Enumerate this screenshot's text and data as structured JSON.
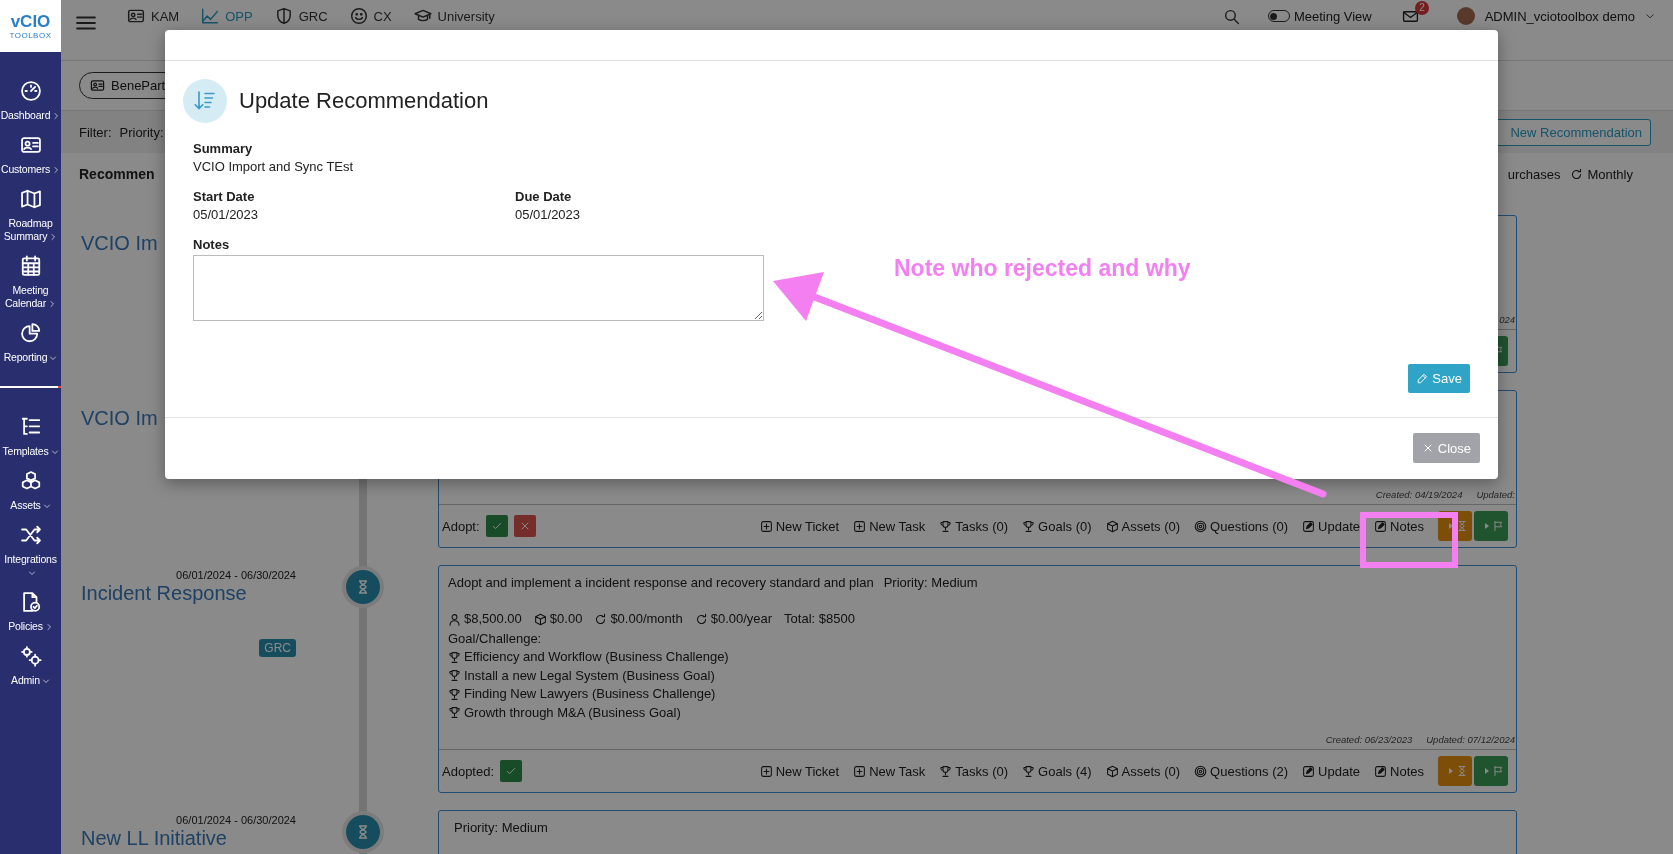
{
  "sidebar": {
    "logo": {
      "name": "vCIO",
      "tagline": "TOOLBOX"
    },
    "sections": [
      {
        "items": [
          {
            "kind": "dashboard",
            "label": "Dashboard",
            "expandable": false
          },
          {
            "kind": "customers",
            "label": "Customers",
            "expandable": false
          },
          {
            "kind": "roadmap",
            "label": "Roadmap Summary",
            "expandable": false
          },
          {
            "kind": "calendar",
            "label": "Meeting Calendar",
            "expandable": false
          },
          {
            "kind": "reporting",
            "label": "Reporting",
            "expandable": true
          }
        ]
      },
      {
        "items": [
          {
            "kind": "templates",
            "label": "Templates",
            "expandable": true
          },
          {
            "kind": "assets",
            "label": "Assets",
            "expandable": true
          },
          {
            "kind": "integrations",
            "label": "Integrations",
            "expandable": true
          },
          {
            "kind": "policies",
            "label": "Policies",
            "expandable": false
          },
          {
            "kind": "admin",
            "label": "Admin",
            "expandable": true
          }
        ]
      }
    ]
  },
  "topbar": {
    "tabs": [
      {
        "kind": "kam",
        "label": "KAM",
        "selected": false
      },
      {
        "kind": "opp",
        "label": "OPP",
        "selected": true
      },
      {
        "kind": "grc",
        "label": "GRC",
        "selected": false
      },
      {
        "kind": "cx",
        "label": "CX",
        "selected": false
      },
      {
        "kind": "university",
        "label": "University",
        "selected": false
      }
    ],
    "meeting_view": {
      "label": "Meeting View",
      "on": false
    },
    "mail_badge": "2",
    "user": "ADMIN_vciotoolbox demo"
  },
  "breadcrumb": {
    "label": "BenePart"
  },
  "filter_bar": {
    "label": "Filter:",
    "priority_label": "Priority:",
    "new_button": "New Recommendation"
  },
  "heading": {
    "title": "Recommen",
    "links": [
      {
        "kind": "plain",
        "label": "urchases"
      },
      {
        "kind": "monthly",
        "label": "Monthly"
      }
    ]
  },
  "timeline": [
    {
      "title": "VCIO Im",
      "card": {
        "updated": "024",
        "footer": {
          "buttons": [
            {
              "kind": "flag"
            }
          ]
        }
      }
    },
    {
      "title": "VCIO Im",
      "card": {
        "created": "Created: 04/19/2024",
        "updated": "Updated:",
        "footer": {
          "label": "Adopt:",
          "adopt_buttons": [
            {
              "kind": "accept"
            },
            {
              "kind": "reject"
            }
          ],
          "actions": [
            {
              "kind": "ticket",
              "label": "New Ticket"
            },
            {
              "kind": "task",
              "label": "New Task"
            },
            {
              "kind": "tasks",
              "label": "Tasks (0)"
            },
            {
              "kind": "goals",
              "label": "Goals (0)"
            },
            {
              "kind": "assets",
              "label": "Assets (0)"
            },
            {
              "kind": "questions",
              "label": "Questions (0)"
            },
            {
              "kind": "update",
              "label": "Update"
            },
            {
              "kind": "notes",
              "label": "Notes"
            }
          ],
          "buttons": [
            {
              "kind": "hourglass"
            },
            {
              "kind": "flag"
            }
          ]
        }
      }
    },
    {
      "date": "06/01/2024 - 06/30/2024",
      "title": "Incident Response",
      "tag": "GRC",
      "card": {
        "description": "Adopt and implement a incident response and recovery standard and plan",
        "priority": "Priority: Medium",
        "costs": [
          {
            "kind": "person",
            "label": "$8,500.00"
          },
          {
            "kind": "cube",
            "label": "$0.00"
          },
          {
            "kind": "recurring",
            "label": "$0.00/month"
          },
          {
            "kind": "recurring",
            "label": "$0.00/year"
          },
          {
            "kind": "total",
            "label": "Total: $8500"
          }
        ],
        "goal_heading": "Goal/Challenge:",
        "goals": [
          "Efficiency and Workflow (Business Challenge)",
          "Install a new Legal System (Business Goal)",
          "Finding New Lawyers (Business Challenge)",
          "Growth through M&A (Business Goal)"
        ],
        "created": "Created: 06/23/2023",
        "updated": "Updated: 07/12/2024",
        "footer": {
          "label": "Adopted:",
          "adopt_buttons": [
            {
              "kind": "accepted"
            }
          ],
          "actions": [
            {
              "kind": "ticket",
              "label": "New Ticket"
            },
            {
              "kind": "task",
              "label": "New Task"
            },
            {
              "kind": "tasks",
              "label": "Tasks (0)"
            },
            {
              "kind": "goals",
              "label": "Goals (4)"
            },
            {
              "kind": "assets",
              "label": "Assets (0)"
            },
            {
              "kind": "questions",
              "label": "Questions (2)"
            },
            {
              "kind": "update",
              "label": "Update"
            },
            {
              "kind": "notes",
              "label": "Notes"
            }
          ],
          "buttons": [
            {
              "kind": "hourglass"
            },
            {
              "kind": "flag"
            }
          ]
        }
      }
    },
    {
      "date": "06/01/2024 - 06/30/2024",
      "title": "New LL Initiative",
      "card": {
        "priority": "Priority: Medium"
      }
    }
  ],
  "modal": {
    "title": "Update Recommendation",
    "summary": {
      "label": "Summary",
      "value": "VCIO Import and Sync TEst"
    },
    "dates": [
      {
        "label": "Start Date",
        "value": "05/01/2023"
      },
      {
        "label": "Due Date",
        "value": "05/01/2023"
      }
    ],
    "notes": {
      "label": "Notes"
    },
    "save": "Save",
    "close": "Close"
  },
  "annotation": {
    "note": "Note who rejected and why"
  }
}
